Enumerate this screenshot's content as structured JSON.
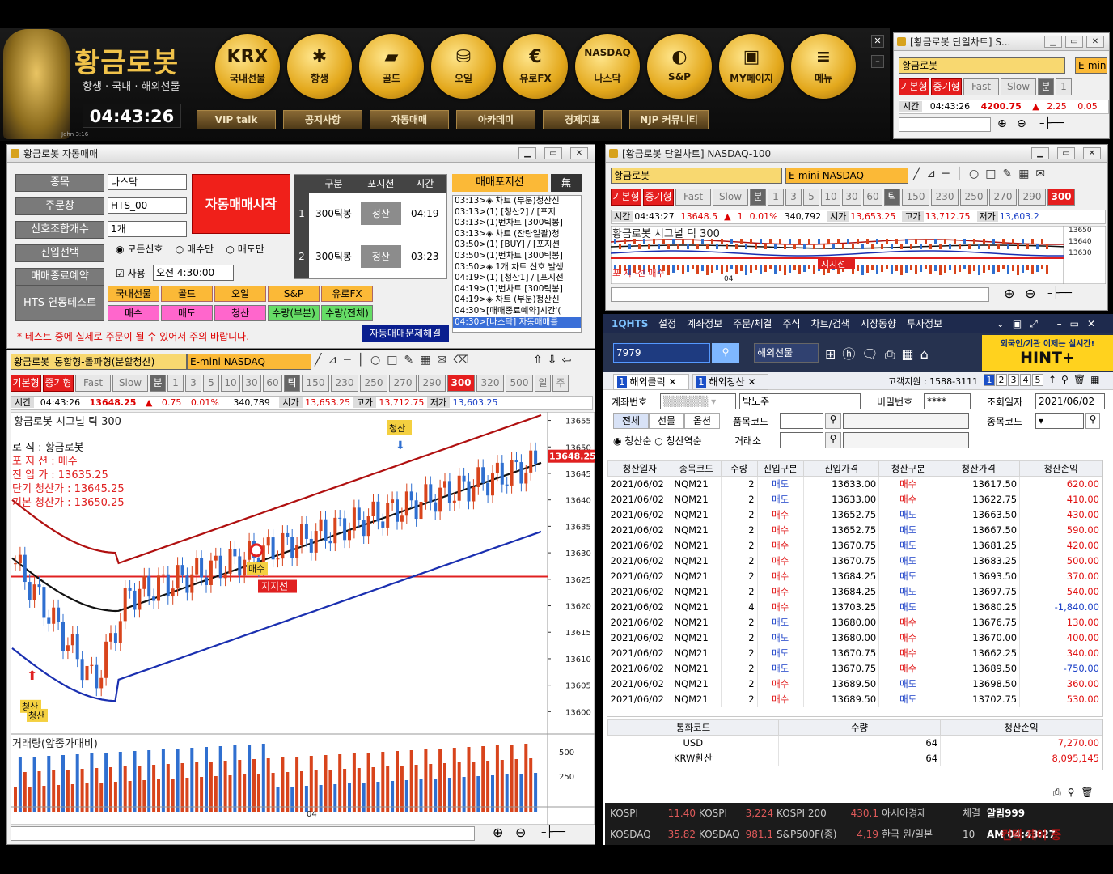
{
  "brand": {
    "name": "황금로봇",
    "sub": "항생 · 국내 · 해외선물",
    "clock": "04:43:26",
    "john": "John 3:16"
  },
  "coins": [
    {
      "ic": "KRX",
      "lb": "국내선물"
    },
    {
      "ic": "✱",
      "lb": "항생"
    },
    {
      "ic": "▰",
      "lb": "골드"
    },
    {
      "ic": "⛁",
      "lb": "오일"
    },
    {
      "ic": "€",
      "lb": "유로FX"
    },
    {
      "ic": "NASDAQ",
      "lb": "나스닥"
    },
    {
      "ic": "◐",
      "lb": "S&P"
    },
    {
      "ic": "▣",
      "lb": "MY페이지"
    },
    {
      "ic": "≡",
      "lb": "메뉴"
    }
  ],
  "gbtns": [
    "VIP talk",
    "공지사항",
    "자동매매",
    "아카데미",
    "경제지표",
    "NJP 커뮤니티"
  ],
  "mini": {
    "title": "[황금로봇 단일차트] S...",
    "name": "황금로봇",
    "sym": "E-min",
    "tabs": [
      "기본형",
      "중기형",
      "Fast",
      "Slow",
      "분",
      "1"
    ],
    "time_lbl": "시간",
    "time": "04:43:26",
    "price": "4200.75",
    "arrow": "▲",
    "chg": "2.25",
    "pct": "0.05"
  },
  "auto": {
    "title": "황금로봇 자동매매",
    "rows": [
      {
        "l": "종목",
        "v": "나스닥"
      },
      {
        "l": "주문창",
        "v": "HTS_00"
      },
      {
        "l": "신호조합개수",
        "v": "1개"
      },
      {
        "l": "진입선택",
        "v": ""
      },
      {
        "l": "매매종료예약",
        "v": ""
      }
    ],
    "start": "자동매매시작",
    "entry_opts": [
      "모든신호",
      "매수만",
      "매도만"
    ],
    "use": "사용",
    "endtime": "오전  4:30:00",
    "hts": "HTS 연동테스트",
    "btns1": [
      "국내선물",
      "골드",
      "오일",
      "S&P",
      "유로FX"
    ],
    "btns2": [
      "매수",
      "매도",
      "청산",
      "수량(부분)",
      "수량(전체)"
    ],
    "warn": "* 테스트 중에 실제로 주문이 될 수 있어서 주의 바랍니다.",
    "fix": "자동매매문제해결",
    "thead": [
      "구분",
      "포지션",
      "시간"
    ],
    "trows": [
      {
        "n": "1",
        "g": "300틱봉",
        "p": "청산",
        "t": "04:19"
      },
      {
        "n": "2",
        "g": "300틱봉",
        "p": "청산",
        "t": "03:23"
      }
    ],
    "ptitle": "매매포지션",
    "none": "無",
    "log": [
      "03:13>◈ 차트 (부분)청산신",
      "03:13>(1) [청산2] / [포지",
      "03:13>(1)번차트 [300틱봉]",
      "03:13>◈ 차트 (잔량일괄)청",
      "03:50>(1) [BUY] / [포지션",
      "03:50>(1)번차트 [300틱봉]",
      "03:50>◈ 1개 차트 신호 발생",
      "04:19>(1) [청산1] / [포지선",
      "04:19>(1)번차트 [300틱봉]",
      "04:19>◈ 차트 (부분)청산신",
      "04:30>[매매종료예약]시간'(",
      "04:30>[나스닥] 자동매매를"
    ]
  },
  "chart": {
    "name": "황금로봇_통합형-돌파형(분할청산)",
    "sym": "E-mini NASDAQ",
    "tabs": [
      "기본형",
      "중기형",
      "Fast",
      "Slow",
      "분",
      "1",
      "3",
      "5",
      "10",
      "30",
      "60",
      "틱",
      "150",
      "230",
      "250",
      "270",
      "290",
      "300",
      "320",
      "500",
      "일",
      "주"
    ],
    "quote": {
      "tl": "시간",
      "t": "04:43:26",
      "p": "13648.25",
      "ar": "▲",
      "c": "0.75",
      "pct": "0.01%",
      "vol": "340,789",
      "ol": "시가",
      "o": "13,653.25",
      "hl": "고가",
      "h": "13,712.75",
      "ll": "저가",
      "l": "13,603.25"
    },
    "sig": "황금로봇 시그널  틱 300",
    "info": [
      "로        직 : 황금로봇",
      "포  지  션 : 매수",
      "진  입  가 : 13635.25",
      "단기 청산가 : 13645.25",
      "기본 청산가 : 13650.25"
    ],
    "last": "13648.25",
    "support": "지지선",
    "buy": "매수",
    "exit": "청산",
    "vol_lbl": "거래량(앞종가대비)",
    "xl": "04"
  },
  "chart_data": {
    "type": "candlestick",
    "title": "황금로봇 시그널  틱 300",
    "y_ticks": [
      13655,
      13650,
      13645,
      13640,
      13635,
      13630,
      13625,
      13620,
      13615,
      13610,
      13605,
      13600
    ],
    "ylim": [
      13597,
      13656
    ],
    "support": 13625.5,
    "last": 13648.25,
    "vol_ticks": [
      500,
      250
    ]
  },
  "nasq": {
    "title": "[황금로봇 단일차트] NASDAQ-100",
    "name": "황금로봇",
    "sym": "E-mini NASDAQ",
    "tabs": [
      "기본형",
      "중기형",
      "Fast",
      "Slow",
      "분",
      "1",
      "3",
      "5",
      "10",
      "30",
      "60",
      "틱",
      "150",
      "230",
      "250",
      "270",
      "290",
      "300"
    ],
    "q": [
      "시간",
      "04:43:27",
      "13648.5",
      "▲",
      "1",
      "0.01%",
      "340,792",
      "시가",
      "13,653.25",
      "고가",
      "13,712.75",
      "저가",
      "13,603.2"
    ],
    "sig": "황금로봇 시그널  틱 300",
    "yt": [
      "13650",
      "13640",
      "13630"
    ],
    "support": "지지선",
    "xl": "04",
    "ov": "포 지 ·선 매수"
  },
  "hts": {
    "logo": "1QHTS",
    "menu": [
      "설정",
      "계좌정보",
      "주문/체결",
      "주식",
      "차트/검색",
      "시장동향",
      "투자정보"
    ],
    "code": "7979",
    "mkt": "해외선물",
    "hint": "외국인/기관 이제는 실시간!",
    "hintb": "HINT+",
    "tabs": [
      "해외클릭",
      "해외청산"
    ],
    "support": "고객지원 : 1588-3111",
    "pages": [
      "1",
      "2",
      "3",
      "4",
      "5"
    ],
    "acct_l": "계좌번호",
    "acct_n": "박노주",
    "pw_l": "비밀번호",
    "pw": "****",
    "date_l": "조회일자",
    "date": "2021/06/02",
    "filters": [
      "전체",
      "선물",
      "옵션"
    ],
    "item_l": "품목코드",
    "code_l": "종목코드",
    "r1": "청산순",
    "r2": "청산역순",
    "ex_l": "거래소",
    "head": [
      "청산일자",
      "종목코드",
      "수량",
      "진입구분",
      "진입가격",
      "청산구분",
      "청산가격",
      "청산손익"
    ],
    "rows": [
      [
        "2021/06/02",
        "NQM21",
        "2",
        "매도",
        "13633.00",
        "매수",
        "13617.50",
        "620.00"
      ],
      [
        "2021/06/02",
        "NQM21",
        "2",
        "매도",
        "13633.00",
        "매수",
        "13622.75",
        "410.00"
      ],
      [
        "2021/06/02",
        "NQM21",
        "2",
        "매수",
        "13652.75",
        "매도",
        "13663.50",
        "430.00"
      ],
      [
        "2021/06/02",
        "NQM21",
        "2",
        "매수",
        "13652.75",
        "매도",
        "13667.50",
        "590.00"
      ],
      [
        "2021/06/02",
        "NQM21",
        "2",
        "매수",
        "13670.75",
        "매도",
        "13681.25",
        "420.00"
      ],
      [
        "2021/06/02",
        "NQM21",
        "2",
        "매수",
        "13670.75",
        "매도",
        "13683.25",
        "500.00"
      ],
      [
        "2021/06/02",
        "NQM21",
        "2",
        "매수",
        "13684.25",
        "매도",
        "13693.50",
        "370.00"
      ],
      [
        "2021/06/02",
        "NQM21",
        "2",
        "매수",
        "13684.25",
        "매도",
        "13697.75",
        "540.00"
      ],
      [
        "2021/06/02",
        "NQM21",
        "4",
        "매수",
        "13703.25",
        "매도",
        "13680.25",
        "-1,840.00"
      ],
      [
        "2021/06/02",
        "NQM21",
        "2",
        "매도",
        "13680.00",
        "매수",
        "13676.75",
        "130.00"
      ],
      [
        "2021/06/02",
        "NQM21",
        "2",
        "매도",
        "13680.00",
        "매수",
        "13670.00",
        "400.00"
      ],
      [
        "2021/06/02",
        "NQM21",
        "2",
        "매도",
        "13670.75",
        "매수",
        "13662.25",
        "340.00"
      ],
      [
        "2021/06/02",
        "NQM21",
        "2",
        "매도",
        "13670.75",
        "매수",
        "13689.50",
        "-750.00"
      ],
      [
        "2021/06/02",
        "NQM21",
        "2",
        "매수",
        "13689.50",
        "매도",
        "13698.50",
        "360.00"
      ],
      [
        "2021/06/02",
        "NQM21",
        "2",
        "매수",
        "13689.50",
        "매도",
        "13702.75",
        "530.00"
      ]
    ],
    "sum_head": [
      "통화코드",
      "수량",
      "청산손익"
    ],
    "sums": [
      [
        "USD",
        "64",
        "7,270.00"
      ],
      [
        "KRW환산",
        "64",
        "8,095,145"
      ]
    ]
  },
  "tick": {
    "r1": [
      "KOSPI",
      "11.40",
      "KOSPI",
      "3,224",
      "KOSPI 200",
      "430.1",
      "아시아경제",
      "체결",
      "알림999"
    ],
    "r2": [
      "KOSDAQ",
      "35.82",
      "KOSDAQ",
      "981.1",
      "S&P500F(종)",
      "4,19",
      "한국 원/일본",
      "10",
      "AM 04:43:27"
    ],
    "watermark": "컨텍 제어 중"
  }
}
